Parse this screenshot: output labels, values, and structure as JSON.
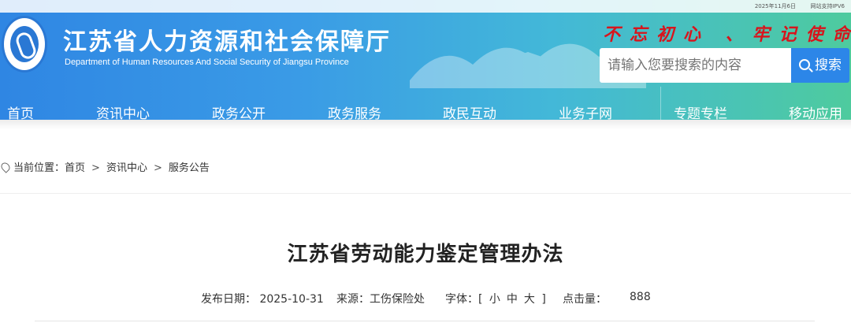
{
  "topbar": {
    "date": "2025年11月6日",
    "ipv6": "网站支持IPV6"
  },
  "site": {
    "title": "江苏省人力资源和社会保障厅",
    "subtitle": "Department of Human Resources And Social Security of Jiangsu Province"
  },
  "slogan": "不忘初心  、牢记使命",
  "search": {
    "placeholder": "请输入您要搜索的内容",
    "button": "搜索"
  },
  "nav": [
    "首页",
    "资讯中心",
    "政务公开",
    "政务服务",
    "政民互动",
    "业务子网",
    "专题专栏",
    "移动应用"
  ],
  "breadcrumb": {
    "label": "当前位置：",
    "items": [
      "首页",
      "资讯中心",
      "服务公告"
    ],
    "separator": ">"
  },
  "article": {
    "title": "江苏省劳动能力鉴定管理办法",
    "publish_label": "发布日期：",
    "publish_date": "2025-10-31",
    "source_label": "来源：",
    "source": "工伤保险处",
    "font_label": "字体：",
    "font_open": "[",
    "font_small": "小",
    "font_medium": "中",
    "font_large": "大",
    "font_close": "]",
    "clicks_label": "点击量：",
    "clicks": "888"
  },
  "colors": {
    "header_start": "#2f86e3",
    "header_end": "#4ecb9e",
    "slogan": "#d8141c",
    "search_button": "#2c86e8"
  }
}
